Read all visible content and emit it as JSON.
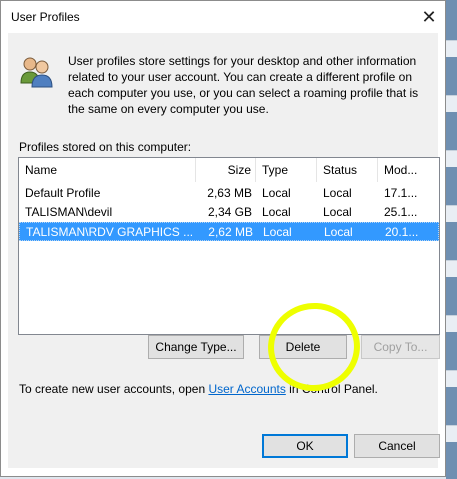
{
  "window": {
    "title": "User Profiles"
  },
  "intro": {
    "text": "User profiles store settings for your desktop and other information related to your user account. You can create a different profile on each computer you use, or you can select a roaming profile that is the same on every computer you use."
  },
  "profiles": {
    "label": "Profiles stored on this computer:",
    "columns": {
      "name": "Name",
      "size": "Size",
      "type": "Type",
      "status": "Status",
      "modified": "Mod..."
    },
    "rows": [
      {
        "name": "Default Profile",
        "size": "2,63 MB",
        "type": "Local",
        "status": "Local",
        "modified": "17.1..."
      },
      {
        "name": "TALISMAN\\devil",
        "size": "2,34 GB",
        "type": "Local",
        "status": "Local",
        "modified": "25.1..."
      },
      {
        "name": "TALISMAN\\RDV GRAPHICS ...",
        "size": "2,62 MB",
        "type": "Local",
        "status": "Local",
        "modified": "20.1..."
      }
    ],
    "selected_row": 3
  },
  "buttons": {
    "change_type": "Change Type...",
    "delete": "Delete",
    "copy_to": "Copy To...",
    "ok": "OK",
    "cancel": "Cancel"
  },
  "footer": {
    "prefix": "To create new user accounts, open ",
    "link": "User Accounts",
    "suffix": " in Control Panel."
  },
  "icons": {
    "close": "close-icon",
    "users": "users-icon"
  },
  "colors": {
    "selection": "#3399ff",
    "link": "#0066cc",
    "annotation": "#eeff00"
  }
}
